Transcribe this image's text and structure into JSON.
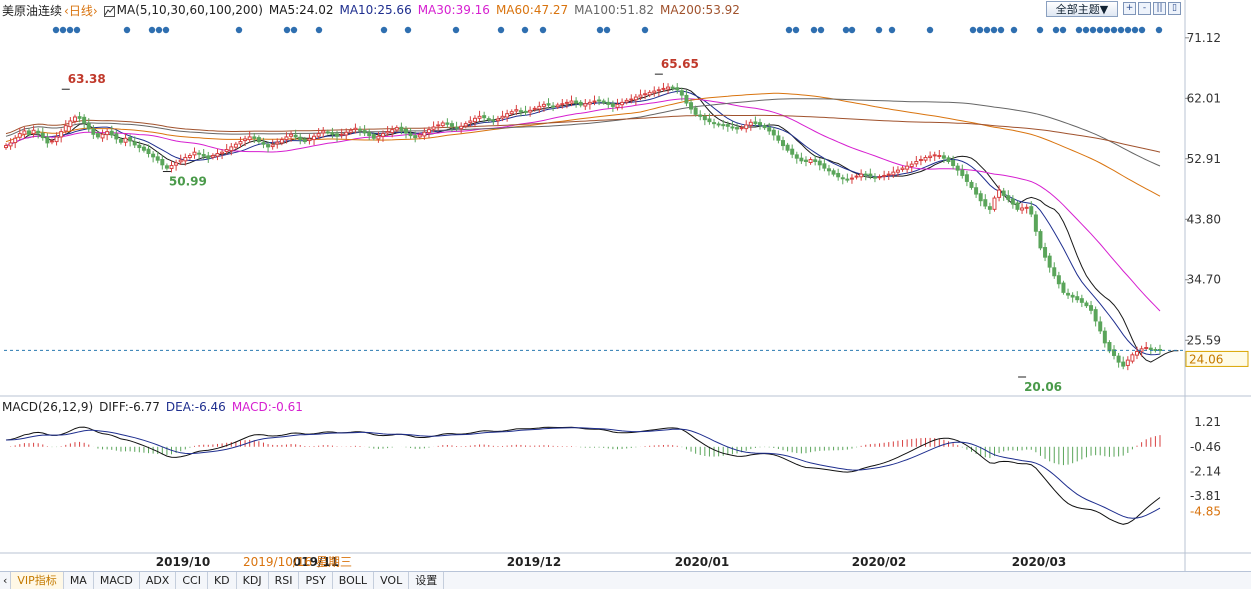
{
  "header": {
    "instrument": "美原油连续",
    "period": "‹日线›",
    "ma_label": "MA(5,10,30,60,100,200)",
    "ma_values": [
      {
        "text": "MA5:24.02",
        "color": "#1a1a1a"
      },
      {
        "text": "MA10:25.66",
        "color": "#1f2f8f"
      },
      {
        "text": "MA30:39.16",
        "color": "#d61fd0"
      },
      {
        "text": "MA60:47.27",
        "color": "#d9740f"
      },
      {
        "text": "MA100:51.82",
        "color": "#666666"
      },
      {
        "text": "MA200:53.92",
        "color": "#a0522d"
      }
    ],
    "theme_button": "全部主题▼",
    "tool_buttons": [
      "+",
      "-",
      "||",
      "▯",
      "|◁"
    ]
  },
  "macd": {
    "label": "MACD(26,12,9)",
    "diff": "DIFF:-6.77",
    "dea": "DEA:-6.46",
    "macd": "MACD:-0.61"
  },
  "bottom_tabs": [
    "",
    "VIP指标",
    "MA",
    "MACD",
    "ADX",
    "CCI",
    "KD",
    "KDJ",
    "RSI",
    "PSY",
    "BOLL",
    "VOL",
    "设置"
  ],
  "active_tab": 1,
  "colors": {
    "up": "#d84040",
    "down": "#5aa55a",
    "ma5": "#1a1a1a",
    "ma10": "#1f2f8f",
    "ma30": "#d61fd0",
    "ma60": "#d9740f",
    "ma100": "#666666",
    "ma200": "#a0522d",
    "current": "#2a7ab0",
    "current_badge": "#d9a400",
    "grid": "#dde3ec",
    "axis_text": "#333333",
    "dots": "#2f6fb0"
  },
  "chart_data": [
    {
      "type": "candlestick",
      "title": "美原油连续",
      "x_labels": [
        "2019/10",
        "019/11",
        "2019/12",
        "2020/01",
        "2020/02",
        "2020/03"
      ],
      "cursor_label": "2019/10/16 星期三",
      "y_ticks": [
        71.12,
        62.01,
        52.91,
        43.8,
        34.7,
        25.59
      ],
      "current_price": 24.06,
      "ylim": [
        17.5,
        73.5
      ],
      "annotations": [
        {
          "text": "63.38",
          "value": 63.38,
          "bar": 13
        },
        {
          "text": "50.99",
          "value": 50.99,
          "bar": 35
        },
        {
          "text": "65.65",
          "value": 65.65,
          "bar": 142
        },
        {
          "text": "20.06",
          "value": 20.06,
          "bar": 221
        }
      ],
      "closes": [
        54.9,
        55.3,
        56.0,
        56.7,
        57.1,
        56.6,
        57.2,
        56.8,
        56.1,
        55.3,
        55.6,
        56.2,
        57.0,
        57.9,
        58.6,
        59.2,
        59.0,
        58.3,
        57.4,
        56.6,
        56.2,
        56.6,
        57.0,
        56.5,
        55.9,
        55.4,
        56.0,
        55.6,
        55.0,
        54.6,
        54.2,
        53.7,
        53.2,
        52.7,
        52.0,
        51.5,
        51.9,
        52.3,
        52.7,
        53.1,
        53.4,
        53.9,
        53.6,
        53.3,
        53.0,
        53.4,
        53.7,
        53.9,
        54.3,
        54.7,
        55.1,
        55.5,
        55.9,
        56.2,
        56.0,
        55.5,
        55.1,
        54.7,
        55.0,
        55.4,
        55.8,
        56.2,
        56.6,
        56.2,
        55.8,
        55.5,
        55.9,
        56.3,
        56.7,
        57.1,
        56.9,
        56.6,
        56.3,
        56.6,
        56.9,
        57.2,
        57.5,
        57.2,
        56.8,
        56.4,
        56.0,
        56.3,
        56.7,
        57.0,
        57.3,
        57.6,
        57.2,
        56.8,
        56.4,
        56.1,
        56.5,
        56.9,
        57.3,
        57.7,
        58.0,
        58.3,
        58.1,
        57.8,
        57.5,
        57.8,
        58.2,
        58.6,
        59.0,
        59.3,
        59.1,
        58.8,
        58.6,
        58.9,
        59.3,
        59.7,
        60.0,
        60.3,
        60.1,
        59.9,
        60.2,
        60.5,
        60.8,
        61.1,
        61.0,
        60.8,
        61.0,
        61.2,
        61.4,
        61.6,
        61.3,
        61.0,
        61.2,
        61.4,
        61.6,
        61.7,
        61.4,
        61.1,
        60.8,
        61.1,
        61.4,
        61.7,
        61.9,
        62.2,
        62.5,
        62.7,
        62.9,
        63.1,
        63.3,
        63.5,
        63.7,
        63.5,
        63.3,
        62.5,
        61.3,
        60.4,
        59.6,
        59.3,
        58.8,
        58.5,
        58.2,
        58.0,
        57.9,
        57.8,
        57.6,
        57.4,
        57.6,
        58.0,
        58.4,
        58.2,
        58.0,
        57.6,
        57.1,
        56.5,
        55.7,
        54.9,
        54.2,
        53.6,
        53.0,
        52.6,
        52.5,
        52.8,
        52.5,
        52.0,
        51.5,
        51.1,
        50.6,
        50.2,
        49.9,
        49.8,
        50.0,
        50.3,
        50.6,
        50.5,
        50.3,
        50.1,
        50.2,
        50.4,
        50.6,
        50.9,
        51.2,
        51.5,
        51.8,
        52.1,
        52.5,
        52.8,
        53.1,
        53.3,
        53.5,
        53.4,
        53.0,
        52.5,
        51.9,
        51.2,
        50.4,
        49.5,
        48.6,
        47.6,
        46.6,
        45.8,
        45.3,
        47.0,
        48.2,
        47.4,
        46.8,
        46.1,
        45.3,
        45.5,
        45.6,
        44.6,
        42.0,
        39.5,
        38.1,
        36.6,
        35.3,
        34.1,
        32.8,
        32.4,
        32.1,
        31.7,
        31.3,
        30.8,
        30.1,
        28.5,
        27.0,
        25.2,
        24.0,
        23.3,
        22.3,
        21.7,
        22.6,
        23.4,
        23.9,
        24.3,
        24.5,
        24.2,
        24.1,
        24.06
      ],
      "ma5": [
        54.9,
        55.1,
        55.4,
        55.7,
        56.0,
        56.5,
        56.6,
        56.6,
        56.3,
        55.9,
        55.7,
        56.0,
        56.3,
        56.6,
        57.0,
        57.6,
        58.1,
        58.2,
        57.9,
        57.5,
        57.0,
        56.6,
        56.6,
        56.6,
        56.3,
        56.0,
        55.9,
        55.7,
        55.5,
        55.3,
        55.1,
        54.9,
        54.4,
        53.9,
        53.4,
        52.9,
        52.6,
        52.3,
        52.1,
        52.1,
        52.3,
        52.6,
        52.9,
        53.1,
        53.2,
        53.4,
        53.5,
        53.6,
        53.7,
        54.0,
        54.3,
        54.7,
        55.1,
        55.4,
        55.6,
        55.7,
        55.6,
        55.4,
        55.2,
        55.1,
        55.2,
        55.4,
        55.7,
        55.9,
        56.1,
        56.0,
        56.0,
        56.0,
        56.0,
        56.2,
        56.4,
        56.5,
        56.5,
        56.6,
        56.7,
        56.7,
        56.9,
        57.0,
        57.0,
        56.9,
        56.7,
        56.5,
        56.4,
        56.5,
        56.6,
        56.8,
        56.9,
        56.9,
        56.9,
        56.8,
        56.6,
        56.5,
        56.6,
        56.7,
        56.9,
        57.1,
        57.3,
        57.5,
        57.6,
        57.7,
        57.9,
        58.1,
        58.3,
        58.5,
        58.6,
        58.7,
        58.8,
        58.9,
        59.1,
        59.3,
        59.5,
        59.7,
        59.8,
        59.9,
        60.0,
        60.2,
        60.3,
        60.5,
        60.6,
        60.7,
        60.8,
        60.9,
        61.0,
        61.1,
        61.2,
        61.2,
        61.2,
        61.2,
        61.3,
        61.3,
        61.3,
        61.2,
        61.2,
        61.2,
        61.3,
        61.4,
        61.6,
        61.8,
        62.0,
        62.2,
        62.5,
        62.7,
        62.9,
        63.1,
        63.2,
        63.4,
        63.5,
        63.5,
        63.4,
        63.1,
        62.5,
        61.8,
        60.9,
        60.1,
        59.4,
        58.9,
        58.5,
        58.3,
        58.1,
        57.9,
        57.7,
        57.7,
        57.7,
        57.7,
        57.8,
        57.9,
        58.0,
        58.0,
        57.9,
        57.5,
        57.0,
        56.4,
        55.7,
        55.1,
        54.4,
        53.8,
        53.3,
        53.1,
        52.9,
        52.7,
        52.4,
        52.2,
        51.8,
        51.4,
        51.0,
        50.7,
        50.4,
        50.2,
        50.1,
        50.1,
        50.2,
        50.3,
        50.3,
        50.3,
        50.3,
        50.3,
        50.4,
        50.6,
        50.8,
        51.0,
        51.3,
        51.6,
        52.0,
        52.3,
        52.6,
        52.8,
        53.0,
        53.2,
        53.3,
        53.2,
        53.0,
        52.5,
        51.8,
        51.1,
        50.2,
        49.3,
        48.4,
        47.5,
        46.7,
        46.1,
        46.0,
        46.5,
        46.9,
        47.1,
        46.9,
        46.6,
        46.0,
        45.6,
        45.3,
        44.6,
        43.4,
        41.9,
        40.1,
        38.3,
        36.7,
        35.3,
        34.3,
        33.4,
        32.7,
        32.1,
        31.6,
        30.9,
        30.0,
        28.8,
        27.3,
        25.7,
        24.3,
        23.3,
        22.6,
        22.3,
        22.7,
        23.1,
        23.5,
        23.8,
        24.0,
        24.02
      ]
    },
    {
      "type": "line",
      "title": "MACD(26,12,9)",
      "series": [
        {
          "name": "DIFF",
          "value": -6.77
        },
        {
          "name": "DEA",
          "value": -6.46
        },
        {
          "name": "MACD",
          "value": -0.61
        }
      ],
      "y_ticks": [
        1.21,
        -0.46,
        -2.14,
        -3.81,
        -4.85
      ],
      "ylim": [
        -7.6,
        1.9
      ]
    }
  ]
}
